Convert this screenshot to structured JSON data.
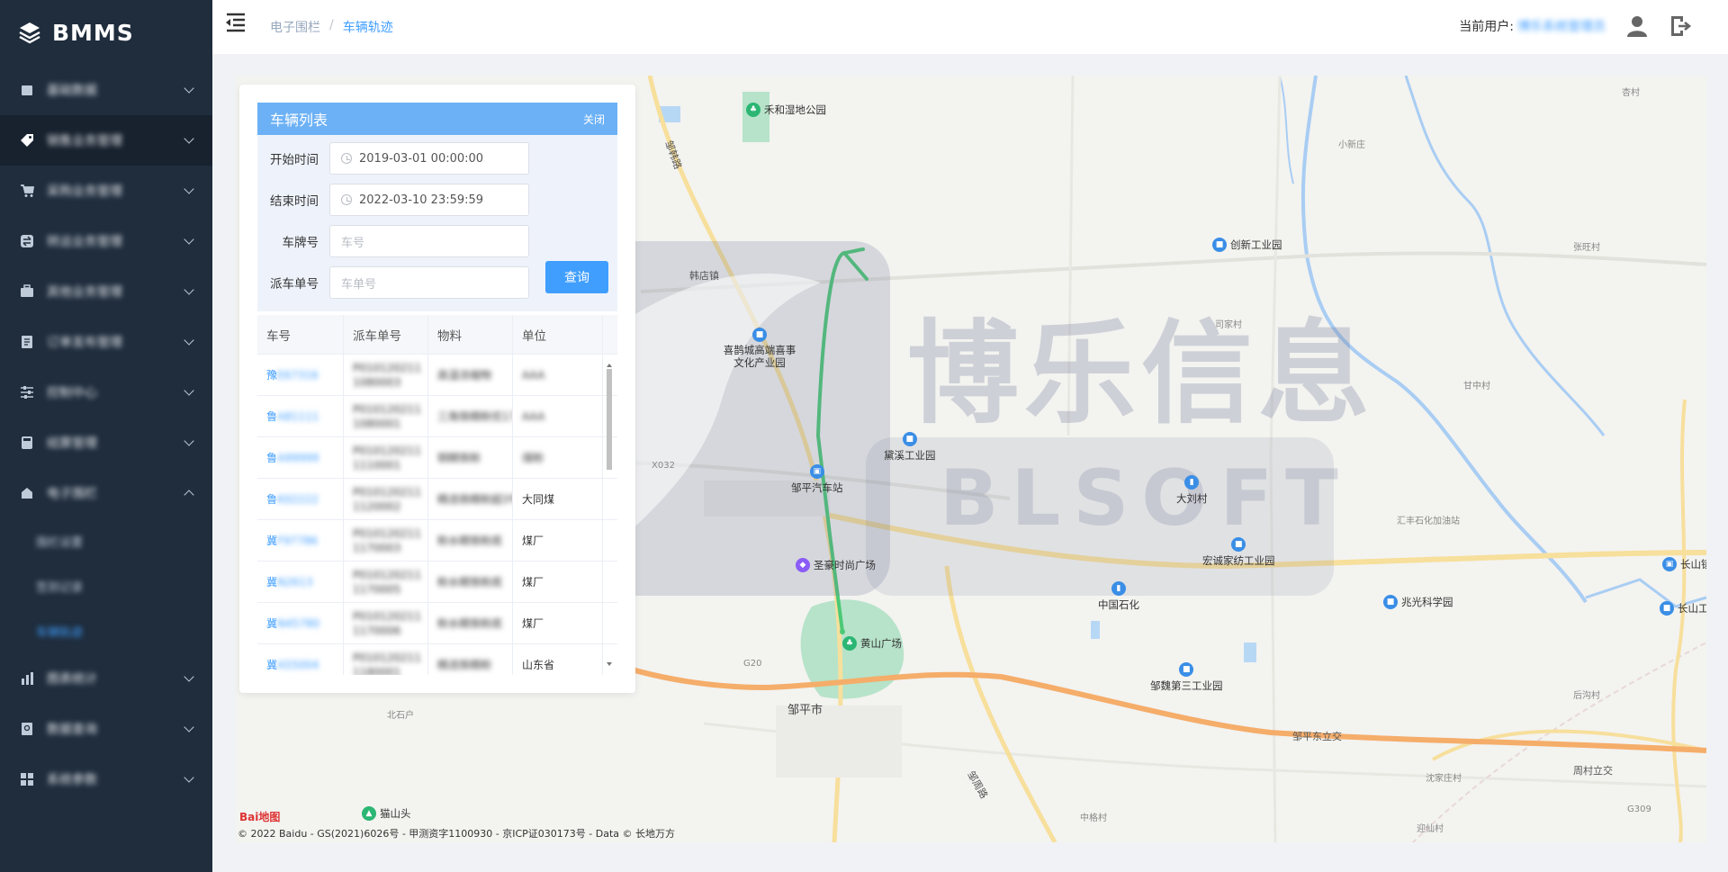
{
  "app": {
    "title": "BMMS"
  },
  "sidebar": {
    "items": [
      {
        "label": "基础数据",
        "icon": "box-icon"
      },
      {
        "label": "销售业务管理",
        "icon": "tag-icon"
      },
      {
        "label": "采购业务管理",
        "icon": "cart-icon"
      },
      {
        "label": "转运业务管理",
        "icon": "transfer-icon"
      },
      {
        "label": "其他业务管理",
        "icon": "briefcase-icon"
      },
      {
        "label": "订单发布管理",
        "icon": "document-icon"
      },
      {
        "label": "控制中心",
        "icon": "sliders-icon"
      },
      {
        "label": "结算管理",
        "icon": "calculator-icon"
      },
      {
        "label": "电子围栏",
        "icon": "fence-icon"
      },
      {
        "label": "图表统计",
        "icon": "chart-icon"
      },
      {
        "label": "数据查询",
        "icon": "search-doc-icon"
      },
      {
        "label": "系统参数",
        "icon": "grid-icon"
      }
    ],
    "subitems": [
      {
        "label": "围栏设置"
      },
      {
        "label": "签到记录"
      },
      {
        "label": "车辆轨迹"
      }
    ]
  },
  "header": {
    "breadcrumb_parent": "电子围栏",
    "breadcrumb_sep": "/",
    "breadcrumb_current": "车辆轨迹",
    "user_label": "当前用户:",
    "user_name": "博乐系统管理员"
  },
  "panel": {
    "title": "车辆列表",
    "close_label": "关闭",
    "start_label": "开始时间",
    "start_value": "2019-03-01 00:00:00",
    "end_label": "结束时间",
    "end_value": "2022-03-10 23:59:59",
    "plate_label": "车牌号",
    "plate_placeholder": "车号",
    "order_label": "派车单号",
    "order_placeholder": "车单号",
    "query_label": "查询",
    "columns": [
      "车号",
      "派车单号",
      "物料",
      "单位"
    ],
    "rows": [
      {
        "plate_prefix": "豫",
        "plate": "E67316",
        "order": "P0101202111080003",
        "material": "高温浓缩物",
        "unit": "AAA"
      },
      {
        "plate_prefix": "鲁",
        "plate": "A81111",
        "order": "P0101202111080001",
        "material": "三角铁精粉优17号",
        "unit": "AAA"
      },
      {
        "plate_prefix": "鲁",
        "plate": "A99999",
        "order": "P0101202111110001",
        "material": "铜精铁粉",
        "unit": "煤粉"
      },
      {
        "plate_prefix": "鲁",
        "plate": "K02222",
        "order": "P0101202111120002",
        "material": "精选铁精粉超3号",
        "unit": "大同煤"
      },
      {
        "plate_prefix": "冀",
        "plate": "F97786",
        "order": "P0101202111170003",
        "material": "粉水精铁粉底",
        "unit": "煤厂"
      },
      {
        "plate_prefix": "冀",
        "plate": "N2613",
        "order": "P0101202111170005",
        "material": "粉水精铁粉底",
        "unit": "煤厂"
      },
      {
        "plate_prefix": "冀",
        "plate": "N45780",
        "order": "P0101202111170006",
        "material": "粉水精铁粉底",
        "unit": "煤厂"
      },
      {
        "plate_prefix": "冀",
        "plate": "A55004",
        "order": "P0101202111180001",
        "material": "精选铁精粉",
        "unit": "山东省"
      }
    ]
  },
  "map": {
    "watermark_cn": "博乐信息",
    "watermark_en": "BLSOFT",
    "labels": [
      "禾和湿地公园",
      "邹韩路",
      "韩店镇",
      "创新工业园",
      "小新庄",
      "杏村",
      "张旺村",
      "司家村",
      "甘中村",
      "喜鹊城高端喜事文化产业园",
      "黛溪工业园",
      "邹平汽车站",
      "汇丰石化加油站",
      "大刘村",
      "宏诚家纺工业园",
      "圣豪时尚广场",
      "中国石化",
      "兆光科学园",
      "长山镇",
      "长山工业",
      "黄山广场",
      "邹魏第三工业园",
      "邹平市",
      "邹平东立交",
      "后沟村",
      "北石户",
      "沈家庄村",
      "周村立交",
      "邹周路",
      "中格村",
      "迎仙村",
      "猫山头",
      "X032",
      "G20",
      "G309"
    ],
    "copyright": "© 2022 Baidu - GS(2021)6026号 - 甲测资字1100930 - 京ICP证030173号 - Data © 长地万方",
    "baidu_logo": "Bai地图"
  },
  "colors": {
    "sidebar_bg": "#1f2d3d",
    "accent": "#409eff",
    "track": "#4cc976",
    "panel_head": "#6cb1f6"
  }
}
